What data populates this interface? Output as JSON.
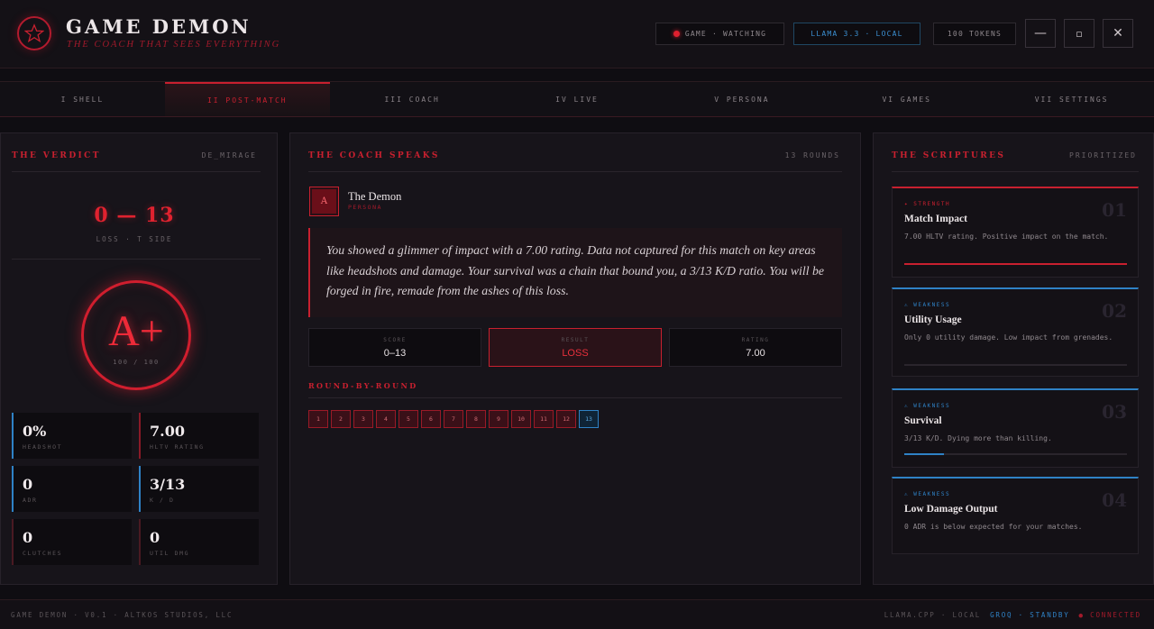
{
  "app": {
    "title": "GAME DEMON",
    "tagline": "THE COACH THAT SEES EVERYTHING"
  },
  "header": {
    "game_status": "GAME · WATCHING",
    "model": "LLAMA 3.3 · LOCAL",
    "tokens": "100 TOKENS",
    "minimize": "—",
    "maximize": "▫",
    "close": "✕"
  },
  "nav": {
    "tabs": [
      {
        "label": "I SHELL"
      },
      {
        "label": "II POST-MATCH"
      },
      {
        "label": "III COACH"
      },
      {
        "label": "IV LIVE"
      },
      {
        "label": "V PERSONA"
      },
      {
        "label": "VI GAMES"
      },
      {
        "label": "VII SETTINGS"
      }
    ],
    "active_index": 1
  },
  "verdict": {
    "title": "THE VERDICT",
    "map": "DE_MIRAGE",
    "score": "0 — 13",
    "score_sub": "LOSS · T SIDE",
    "grade": "A+",
    "grade_sub": "100 / 100",
    "stats": [
      {
        "value": "0%",
        "label": "HEADSHOT"
      },
      {
        "value": "7.00",
        "label": "HLTV RATING"
      },
      {
        "value": "0",
        "label": "ADR"
      },
      {
        "value": "3/13",
        "label": "K / D"
      },
      {
        "value": "0",
        "label": "CLUTCHES"
      },
      {
        "value": "0",
        "label": "UTIL DMG"
      }
    ]
  },
  "coach": {
    "title": "THE COACH SPEAKS",
    "rounds_count": "13 ROUNDS",
    "avatar_glyph": "A",
    "name": "The Demon",
    "role": "PERSONA",
    "message": "You showed a glimmer of impact with a 7.00 rating. Data not captured for this match on key areas like headshots and damage. Your survival was a chain that bound you, a 3/13 K/D ratio. You will be forged in fire, remade from the ashes of this loss.",
    "summary": [
      {
        "label": "SCORE",
        "value": "0–13"
      },
      {
        "label": "RESULT",
        "value": "LOSS"
      },
      {
        "label": "RATING",
        "value": "7.00"
      }
    ],
    "round_title": "ROUND-BY-ROUND",
    "rounds": [
      {
        "n": "1",
        "result": "loss"
      },
      {
        "n": "2",
        "result": "loss"
      },
      {
        "n": "3",
        "result": "loss"
      },
      {
        "n": "4",
        "result": "loss"
      },
      {
        "n": "5",
        "result": "loss"
      },
      {
        "n": "6",
        "result": "loss"
      },
      {
        "n": "7",
        "result": "loss"
      },
      {
        "n": "8",
        "result": "loss"
      },
      {
        "n": "9",
        "result": "loss"
      },
      {
        "n": "10",
        "result": "loss"
      },
      {
        "n": "11",
        "result": "loss"
      },
      {
        "n": "12",
        "result": "loss"
      },
      {
        "n": "13",
        "result": "win"
      }
    ]
  },
  "scriptures": {
    "title": "THE SCRIPTURES",
    "meta": "PRIORITIZED",
    "cards": [
      {
        "tag": "✦ STRENGTH",
        "num": "01",
        "title": "Match Impact",
        "desc": "7.00 HLTV rating. Positive impact on the match.",
        "progress": 1.0,
        "color": "#c8202f"
      },
      {
        "tag": "⚠ WEAKNESS",
        "num": "02",
        "title": "Utility Usage",
        "desc": "Only 0 utility damage. Low impact from grenades.",
        "progress": 0.0,
        "color": "#2f82c6"
      },
      {
        "tag": "⚠ WEAKNESS",
        "num": "03",
        "title": "Survival",
        "desc": "3/13 K/D. Dying more than killing.",
        "progress": 0.18,
        "color": "#2f82c6"
      },
      {
        "tag": "⚠ WEAKNESS",
        "num": "04",
        "title": "Low Damage Output",
        "desc": "0 ADR is below expected for your matches.",
        "progress": 0.0,
        "color": "#2f82c6"
      }
    ]
  },
  "footer": {
    "left": "GAME DEMON · V0.1 · ALTKOS STUDIOS, LLC",
    "engine": "LLAMA.CPP · LOCAL",
    "groq": "GROQ · STANDBY",
    "status": "● CONNECTED"
  },
  "colors": {
    "accent_red": "#c8202f",
    "accent_blue": "#2f82c6",
    "background": "#0f0d12"
  }
}
